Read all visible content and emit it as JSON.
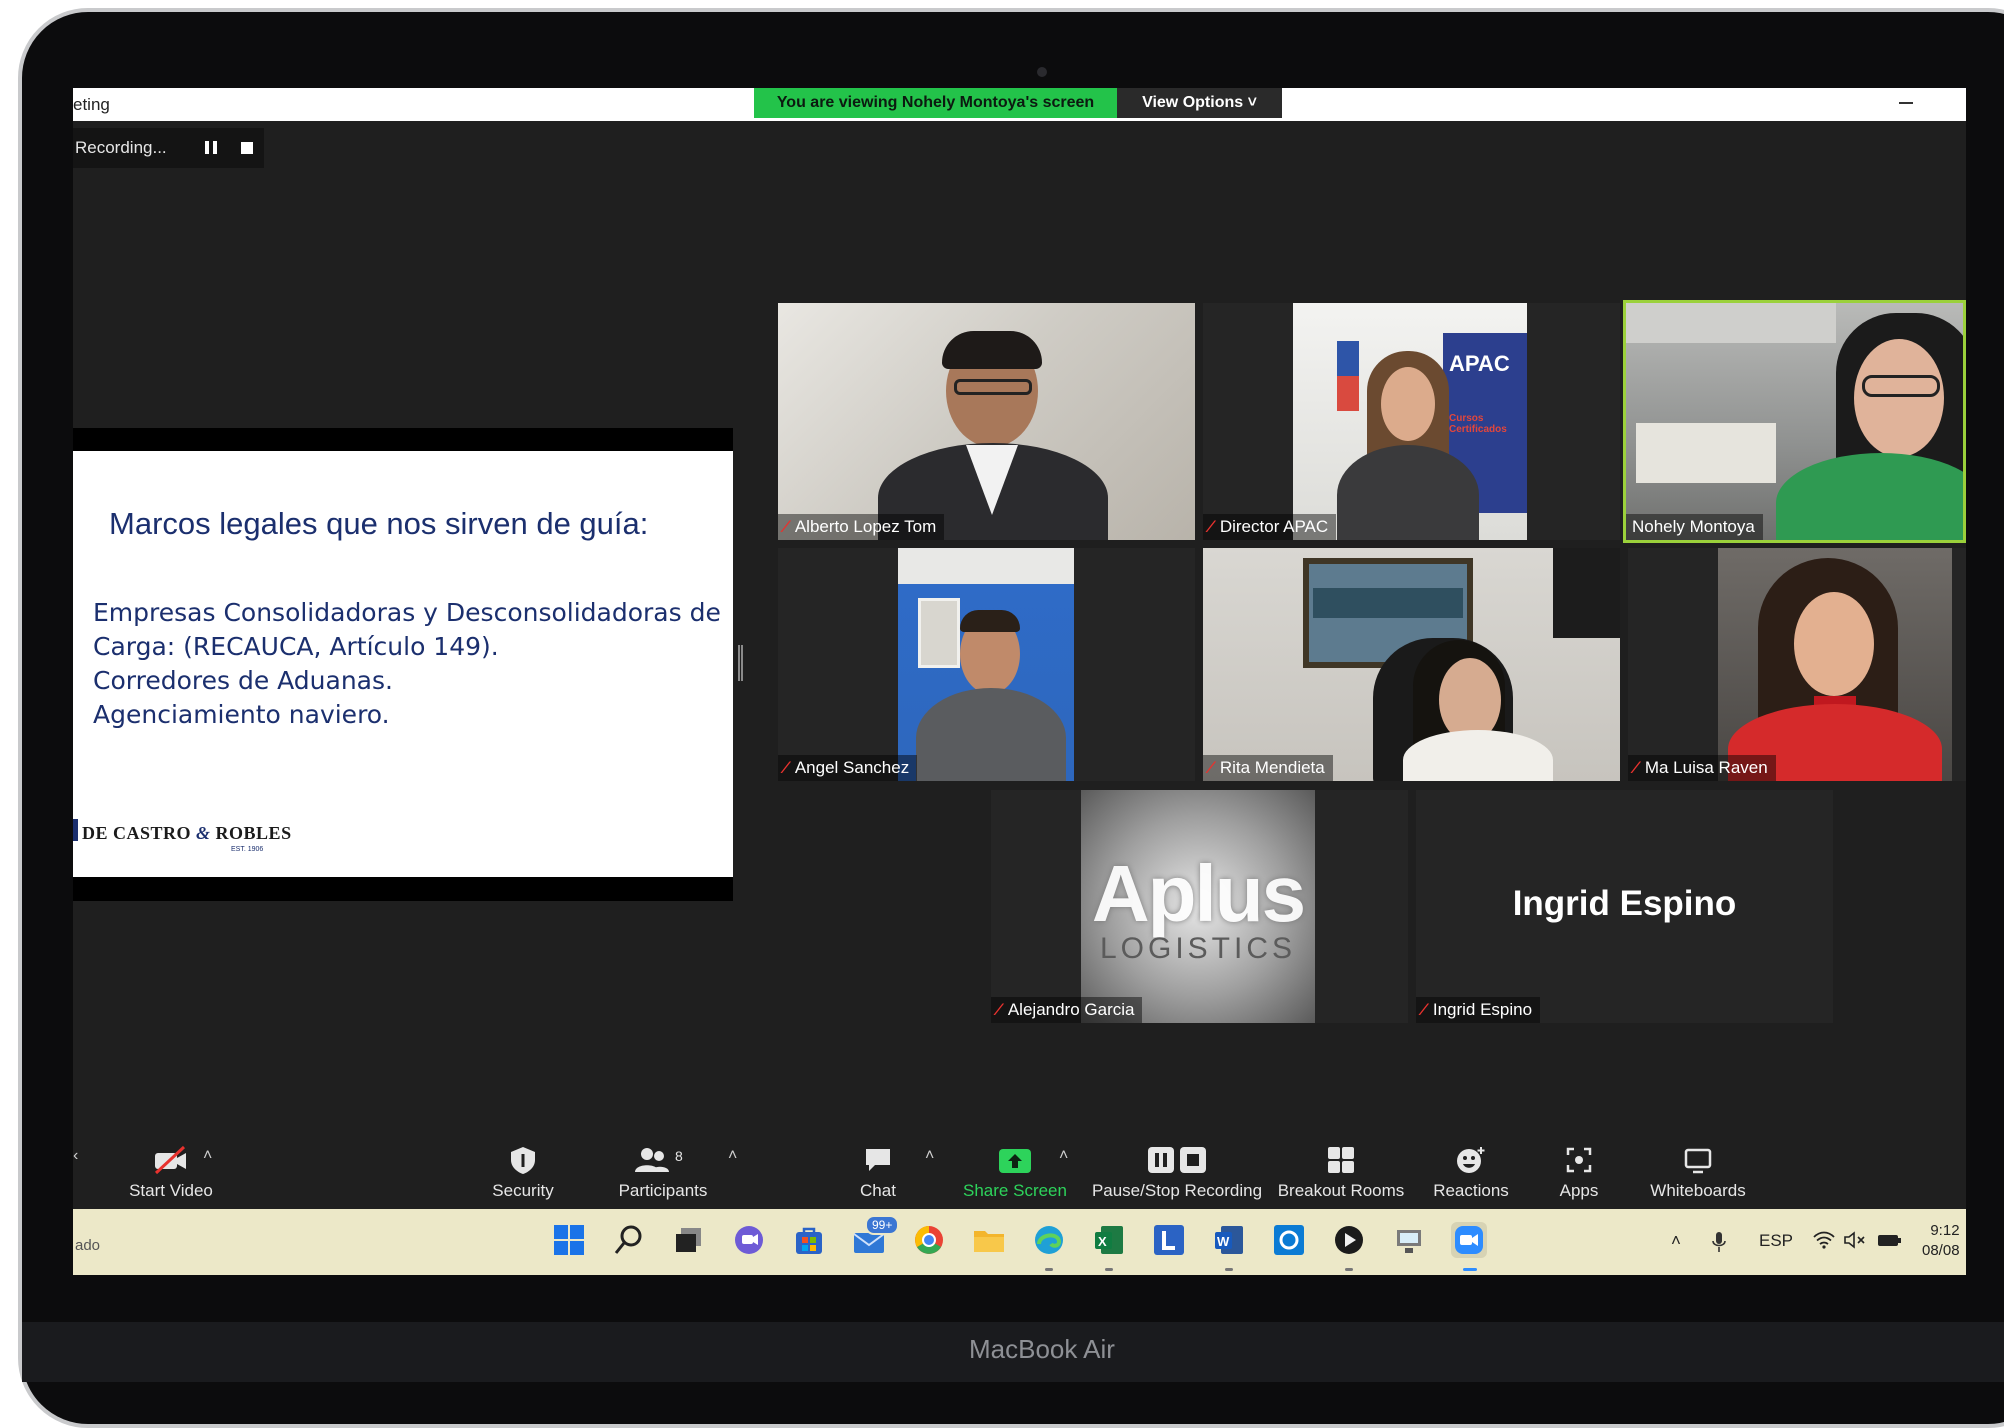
{
  "device_label": "MacBook Air",
  "window": {
    "title_fragment": "eting",
    "share_banner": "You are viewing Nohely Montoya's screen",
    "view_options": "View Options ˅"
  },
  "recording": {
    "label": "Recording..."
  },
  "shared_slide": {
    "title": "Marcos legales que nos sirven de guía:",
    "lines": [
      "Empresas Consolidadoras y Desconsolidadoras de",
      "Carga: (RECAUCA, Artículo 149).",
      "Corredores de Aduanas.",
      "Agenciamiento naviero."
    ],
    "logo_a": "DE CASTRO",
    "logo_amp": "&",
    "logo_b": "ROBLES",
    "logo_est": "EST. 1906"
  },
  "participants": [
    {
      "name": "Alberto Lopez Tom",
      "muted": true
    },
    {
      "name": "Director APAC",
      "muted": true
    },
    {
      "name": "Nohely Montoya",
      "muted": false,
      "active_speaker": true
    },
    {
      "name": "Angel Sanchez",
      "muted": true
    },
    {
      "name": "Rita Mendieta",
      "muted": true
    },
    {
      "name": "Ma Luisa Raven",
      "muted": true
    },
    {
      "name": "Alejandro Garcia",
      "muted": true
    },
    {
      "name": "Ingrid Espino",
      "muted": true
    }
  ],
  "video_placeholders": {
    "apac_sign": "APAC",
    "apac_sub": "Cursos Certificados",
    "aplus_logo": "Aplus",
    "aplus_sub": "LOGISTICS",
    "ingrid_display": "Ingrid Espino"
  },
  "toolbar": {
    "start_video": "Start Video",
    "security": "Security",
    "participants": "Participants",
    "participants_count": "8",
    "chat": "Chat",
    "share_screen": "Share Screen",
    "pause_stop_recording": "Pause/Stop Recording",
    "breakout_rooms": "Breakout Rooms",
    "reactions": "Reactions",
    "apps": "Apps",
    "whiteboards": "Whiteboards"
  },
  "taskbar": {
    "left_text": "ado",
    "mail_badge": "99+",
    "language": "ESP",
    "time": "9:12",
    "date": "08/08"
  },
  "colors": {
    "share_banner": "#23c34a",
    "share_screen_green": "#2dd35b",
    "active_speaker_border": "#9bd13b",
    "slide_text": "#1b2f6e",
    "muted_icon": "#e8322e"
  }
}
